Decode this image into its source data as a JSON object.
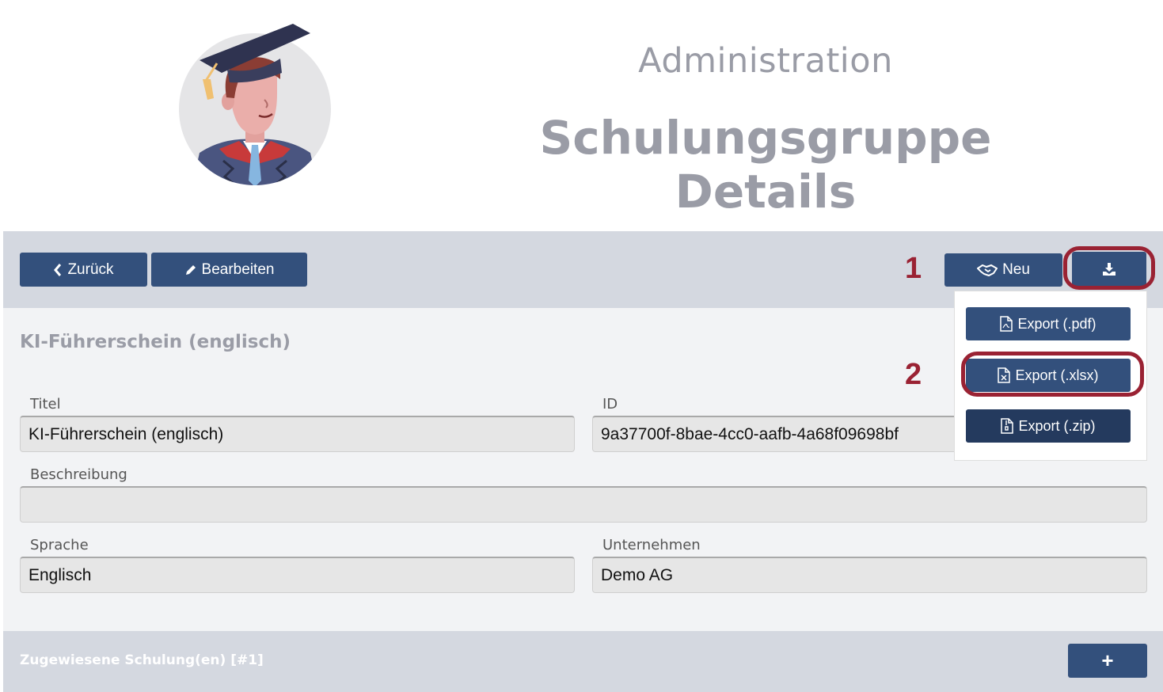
{
  "header": {
    "subtitle": "Administration",
    "title": "Schulungsgruppe Details"
  },
  "toolbar": {
    "back_label": "Zurück",
    "edit_label": "Bearbeiten",
    "new_label": "Neu"
  },
  "annotations": {
    "marker_1": "1",
    "marker_2": "2",
    "highlight_color": "#9a2233"
  },
  "export_menu": {
    "items": [
      {
        "label": "Export (.pdf)",
        "icon": "file-pdf-icon"
      },
      {
        "label": "Export (.xlsx)",
        "icon": "file-excel-icon"
      },
      {
        "label": "Export (.zip)",
        "icon": "file-zip-icon"
      }
    ]
  },
  "form": {
    "group_title": "KI-Führerschein (englisch)",
    "titel_label": "Titel",
    "titel_value": "KI-Führerschein (englisch)",
    "id_label": "ID",
    "id_value": "9a37700f-8bae-4cc0-aafb-4a68f09698bf",
    "beschreibung_label": "Beschreibung",
    "beschreibung_value": "",
    "sprache_label": "Sprache",
    "sprache_value": "Englisch",
    "unternehmen_label": "Unternehmen",
    "unternehmen_value": "Demo AG"
  },
  "assigned": {
    "title": "Zugewiesene Schulung(en) [#1]",
    "add_label": "+"
  },
  "colors": {
    "primary_button": "#33507c",
    "dark_button": "#243a5e",
    "toolbar_bg": "#d4d8e0",
    "heading_gray": "#9a9ca6"
  }
}
